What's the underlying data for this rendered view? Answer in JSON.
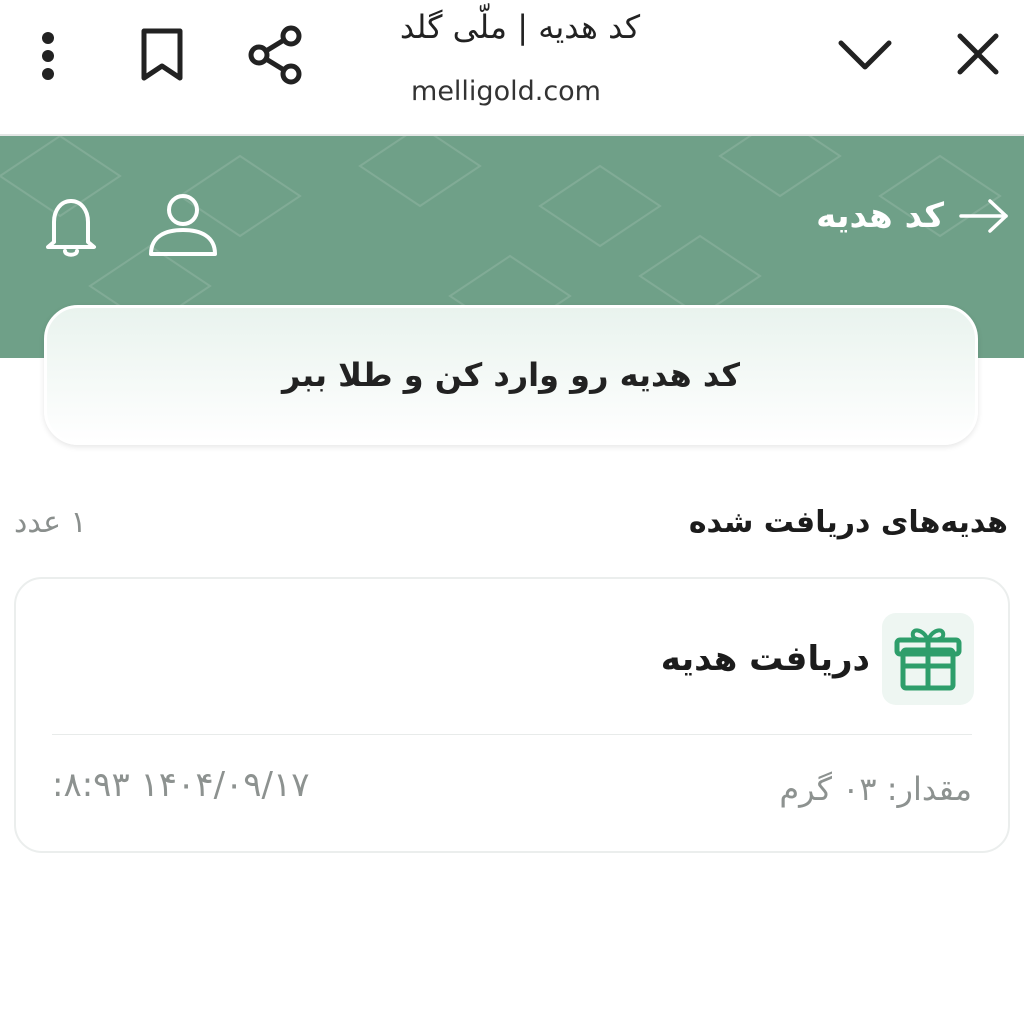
{
  "browser": {
    "title": "کد هدیه | ملّی گلد",
    "url": "melligold.com",
    "icons": [
      "more-vert-icon",
      "bookmark-icon",
      "share-icon",
      "chevron-down-icon",
      "close-icon"
    ]
  },
  "header": {
    "back_label": "کد هدیه",
    "icons": [
      "arrow-right-icon",
      "user-icon",
      "bell-icon"
    ],
    "accent_color": "#6fa088"
  },
  "gift_code_input": {
    "placeholder": "کد هدیه رو وارد کن و طلا ببر"
  },
  "received_section": {
    "title": "هدیه‌های دریافت شده",
    "count": "۱ عدد"
  },
  "gift_item": {
    "title": "دریافت هدیه",
    "amount": "مقدار: ۰۳ گرم",
    "datetime": "۱۴۰۴/۰۹/۱۷  ۸:۹۳:",
    "icon": "gift-icon",
    "icon_color": "#2e9e6b"
  }
}
